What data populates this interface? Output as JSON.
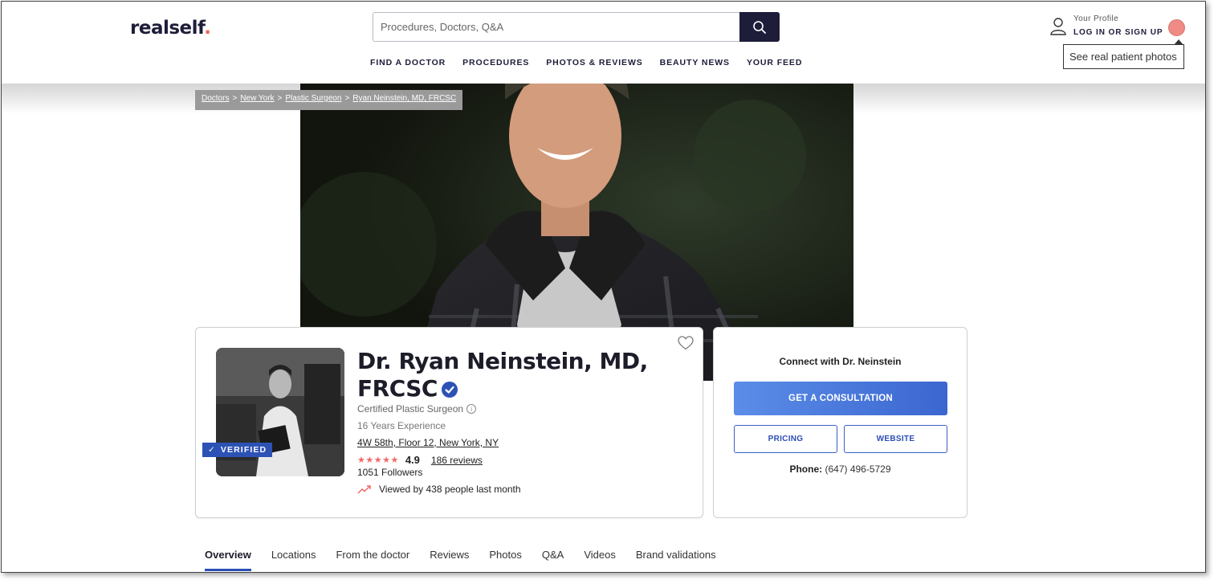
{
  "header": {
    "logo_text": "realself",
    "logo_dot": ".",
    "search_placeholder": "Procedures, Doctors, Q&A",
    "nav": [
      "FIND A DOCTOR",
      "PROCEDURES",
      "PHOTOS & REVIEWS",
      "BEAUTY NEWS",
      "YOUR FEED"
    ],
    "profile_small": "Your Profile",
    "profile_login": "LOG IN OR SIGN UP",
    "tooltip": "See real patient photos"
  },
  "breadcrumb": [
    "Doctors",
    "New York",
    "Plastic Surgeon",
    "Ryan Neinstein, MD, FRCSC"
  ],
  "breadcrumb_sep": ">",
  "doctor": {
    "verified_label": "VERIFIED",
    "name": "Dr. Ryan Neinstein, MD, FRCSC",
    "specialty": "Certified Plastic Surgeon",
    "experience": "16 Years Experience",
    "address": "4W 58th, Floor 12, New York, NY",
    "stars": "★★★★★",
    "rating": "4.9",
    "reviews": "186 reviews",
    "followers": "1051 Followers",
    "views": "Viewed by 438 people last month"
  },
  "contact": {
    "title": "Connect with Dr. Neinstein",
    "consult_button": "GET A CONSULTATION",
    "pricing_button": "PRICING",
    "website_button": "WEBSITE",
    "phone_label": "Phone:",
    "phone_number": "(647) 496-5729"
  },
  "tabs": [
    "Overview",
    "Locations",
    "From the doctor",
    "Reviews",
    "Photos",
    "Q&A",
    "Videos",
    "Brand validations"
  ],
  "colors": {
    "brand_navy": "#1d1d3a",
    "accent_blue": "#2d52b5",
    "star_coral": "#f06a66"
  }
}
